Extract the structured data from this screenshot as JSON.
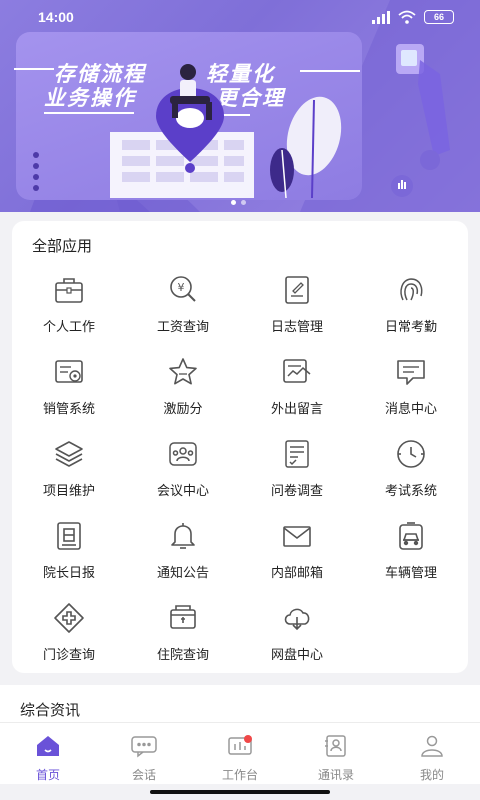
{
  "status_bar": {
    "time": "14:00",
    "battery": "66"
  },
  "banner": {
    "slogan_line1_left": "存储流程",
    "slogan_line1_right": "轻量化",
    "slogan_line2_left": "业务操作",
    "slogan_line2_right": "更合理"
  },
  "apps": {
    "title": "全部应用",
    "items": [
      {
        "label": "个人工作",
        "icon": "briefcase-icon"
      },
      {
        "label": "工资查询",
        "icon": "salary-search-icon"
      },
      {
        "label": "日志管理",
        "icon": "log-edit-icon"
      },
      {
        "label": "日常考勤",
        "icon": "fingerprint-icon"
      },
      {
        "label": "销管系统",
        "icon": "sales-icon"
      },
      {
        "label": "激励分",
        "icon": "star-icon"
      },
      {
        "label": "外出留言",
        "icon": "outing-message-icon"
      },
      {
        "label": "消息中心",
        "icon": "message-icon"
      },
      {
        "label": "项目维护",
        "icon": "layers-icon"
      },
      {
        "label": "会议中心",
        "icon": "meeting-icon"
      },
      {
        "label": "问卷调查",
        "icon": "survey-icon"
      },
      {
        "label": "考试系统",
        "icon": "clock-icon"
      },
      {
        "label": "院长日报",
        "icon": "daily-report-icon"
      },
      {
        "label": "通知公告",
        "icon": "bell-icon"
      },
      {
        "label": "内部邮箱",
        "icon": "mail-icon"
      },
      {
        "label": "车辆管理",
        "icon": "car-icon"
      },
      {
        "label": "门诊查询",
        "icon": "clinic-cross-icon"
      },
      {
        "label": "住院查询",
        "icon": "hospital-bed-icon"
      },
      {
        "label": "网盘中心",
        "icon": "cloud-download-icon"
      }
    ]
  },
  "news": {
    "title": "综合资讯"
  },
  "tabbar": {
    "items": [
      {
        "label": "首页",
        "icon": "home-icon",
        "active": true
      },
      {
        "label": "会话",
        "icon": "chat-icon",
        "active": false
      },
      {
        "label": "工作台",
        "icon": "workbench-icon",
        "active": false,
        "badge": true
      },
      {
        "label": "通讯录",
        "icon": "contacts-icon",
        "active": false
      },
      {
        "label": "我的",
        "icon": "profile-icon",
        "active": false
      }
    ]
  },
  "colors": {
    "accent": "#6a52d8",
    "banner": "#8c7de0",
    "badge": "#f04848"
  }
}
